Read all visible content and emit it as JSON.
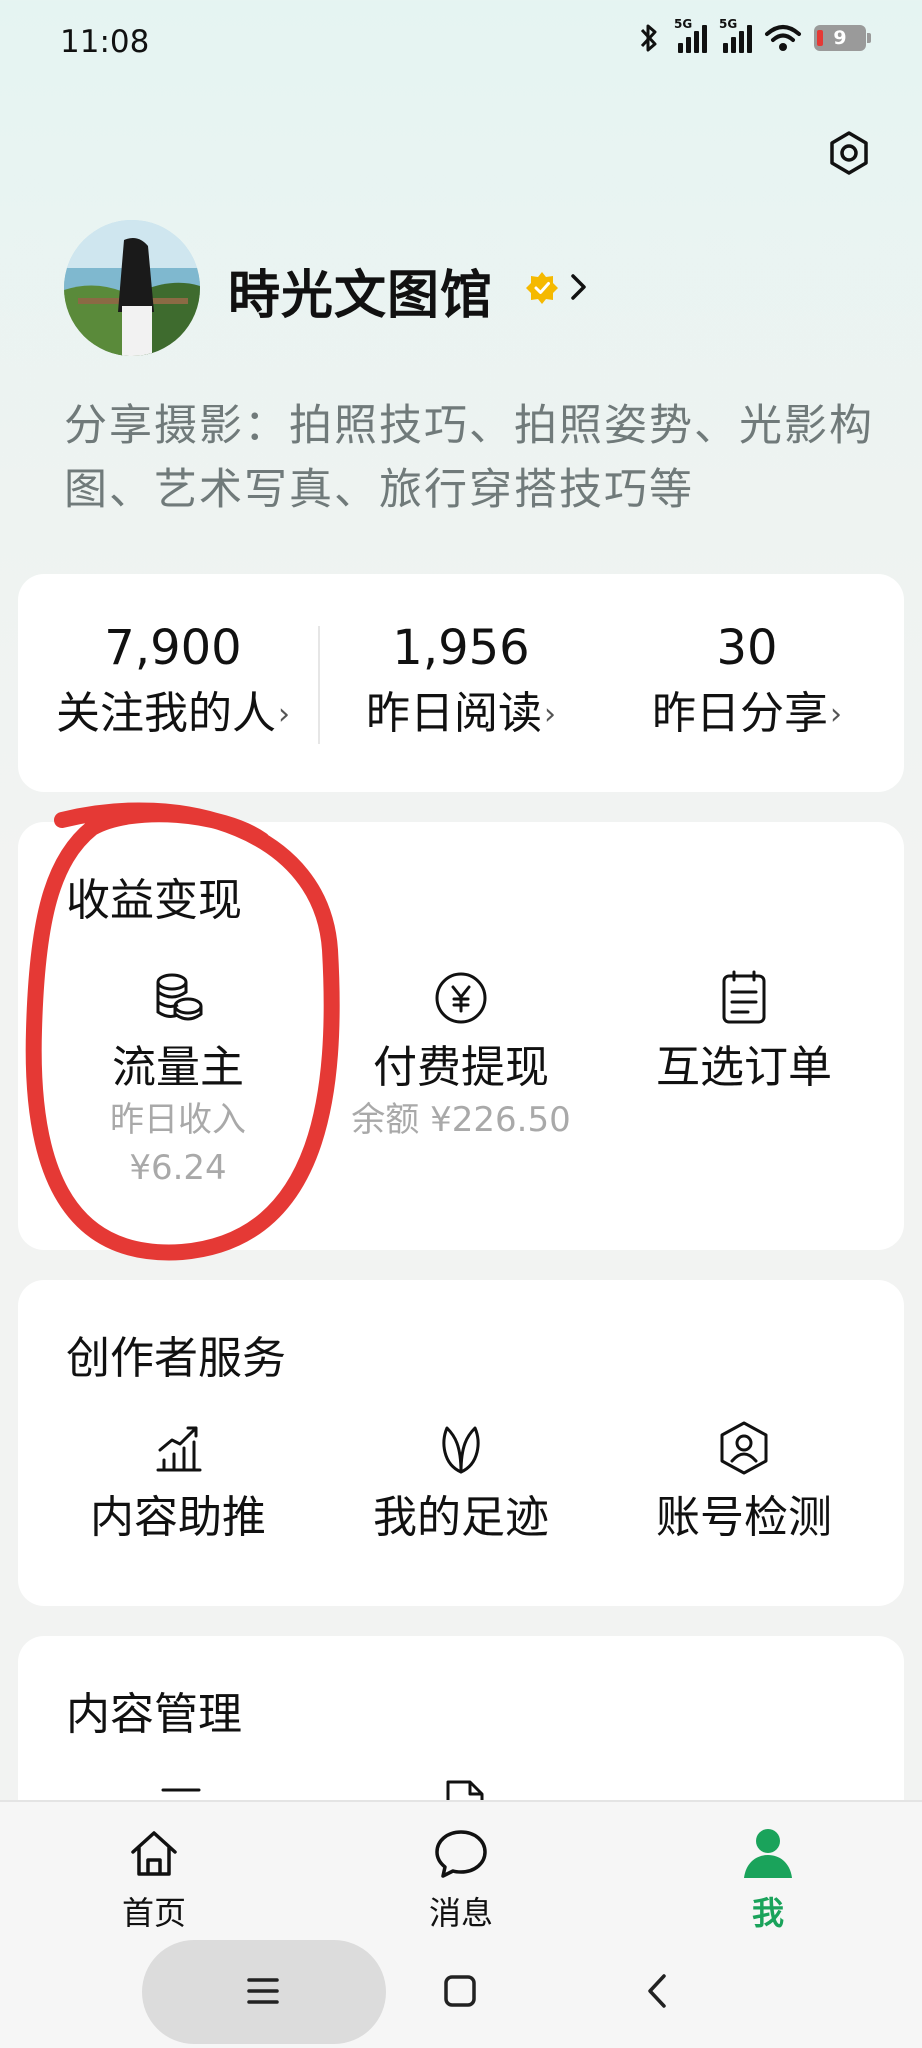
{
  "status_bar": {
    "time": "11:08",
    "network_1": "5G",
    "network_2": "5G",
    "battery": "9"
  },
  "profile": {
    "name": "時光文图馆",
    "bio": "分享摄影：拍照技巧、拍照姿势、光影构图、艺术写真、旅行穿搭技巧等",
    "verified_color": "#f5b900"
  },
  "stats": [
    {
      "value": "7,900",
      "label": "关注我的人"
    },
    {
      "value": "1,956",
      "label": "昨日阅读"
    },
    {
      "value": "30",
      "label": "昨日分享"
    }
  ],
  "earnings": {
    "title": "收益变现",
    "items": [
      {
        "label": "流量主",
        "sub1": "昨日收入",
        "sub2": "¥6.24",
        "icon": "coins-icon"
      },
      {
        "label": "付费提现",
        "sub1": "余额 ¥226.50",
        "icon": "yen-icon"
      },
      {
        "label": "互选订单",
        "icon": "clipboard-icon"
      }
    ]
  },
  "creator": {
    "title": "创作者服务",
    "items": [
      {
        "label": "内容助推",
        "icon": "growth-chart-icon"
      },
      {
        "label": "我的足迹",
        "icon": "sprout-icon"
      },
      {
        "label": "账号检测",
        "icon": "account-shield-icon"
      }
    ]
  },
  "content": {
    "title": "内容管理"
  },
  "nav": {
    "items": [
      {
        "label": "首页",
        "icon": "home-icon"
      },
      {
        "label": "消息",
        "icon": "message-icon"
      },
      {
        "label": "我",
        "icon": "profile-icon",
        "active": true
      }
    ],
    "active_color": "#1aa35b"
  },
  "annotation_color": "#e53935"
}
